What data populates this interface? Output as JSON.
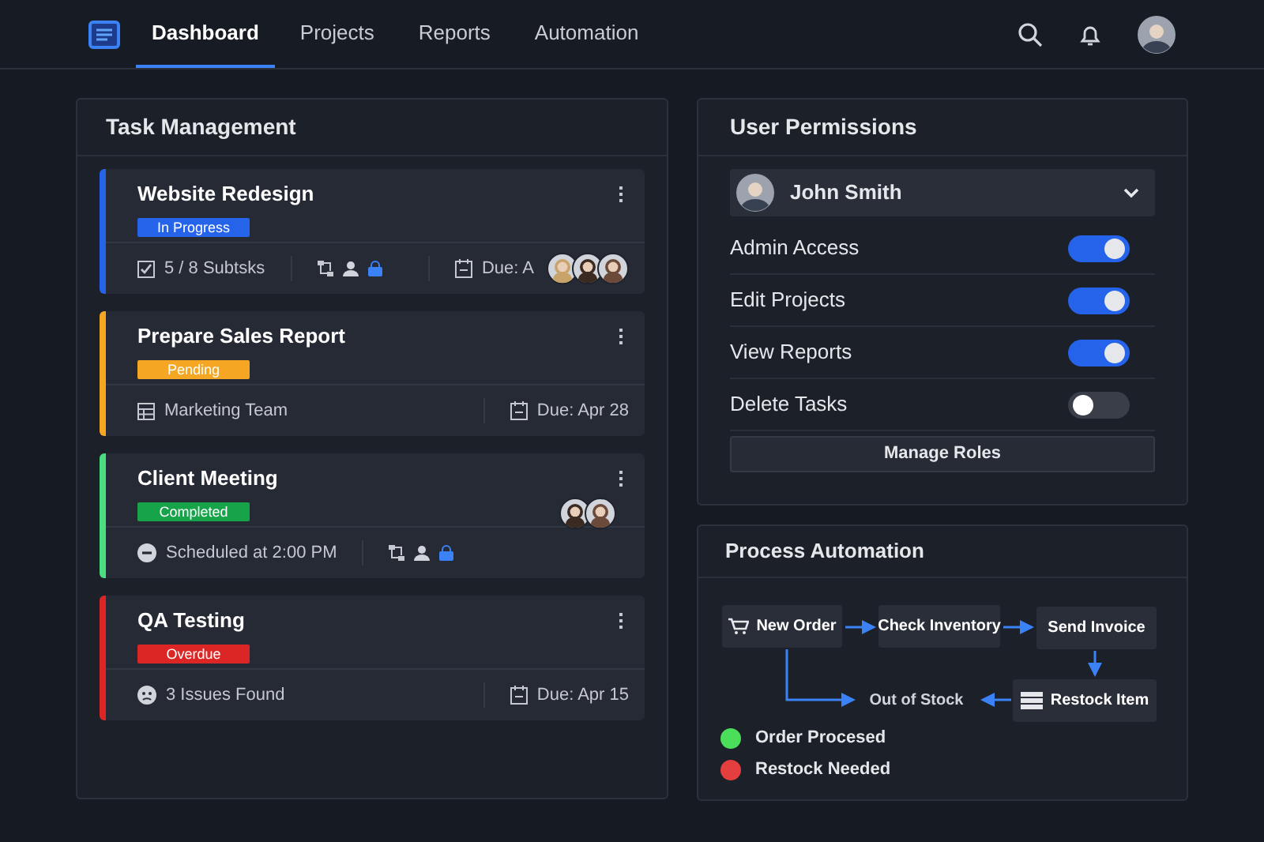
{
  "nav": {
    "items": [
      {
        "label": "Dashboard",
        "selected": true
      },
      {
        "label": "Projects",
        "selected": false
      },
      {
        "label": "Reports",
        "selected": false
      },
      {
        "label": "Automation",
        "selected": false
      }
    ]
  },
  "task_management": {
    "title": "Task Management",
    "tasks": [
      {
        "title": "Website Redesign",
        "status": {
          "kind": "in_progress",
          "label": "In Progress"
        },
        "footer": [
          {
            "kind": "check",
            "text": "5 / 8 Subtsks"
          },
          {
            "kind": "icons"
          },
          {
            "kind": "due",
            "text": "Due: A",
            "avatars": [
              {
                "kind": "picture"
              },
              {
                "kind": "picture"
              },
              {
                "kind": "picture"
              }
            ]
          }
        ]
      },
      {
        "title": "Prepare Sales Report",
        "status": {
          "kind": "pending",
          "label": "Pending"
        },
        "footer": [
          {
            "kind": "team",
            "text": "Marketing Team"
          },
          {
            "kind": "due",
            "text": "Due: Apr 28"
          }
        ]
      },
      {
        "title": "Client Meeting",
        "status": {
          "kind": "completed",
          "label": "Completed"
        },
        "top_avatars": [
          {
            "kind": "picture"
          },
          {
            "kind": "picture"
          }
        ],
        "footer": [
          {
            "kind": "clock",
            "text": "Scheduled at 2:00 PM"
          },
          {
            "kind": "icons"
          }
        ]
      },
      {
        "title": "QA Testing",
        "status": {
          "kind": "overdue",
          "label": "Overdue"
        },
        "footer": [
          {
            "kind": "bug",
            "text": "3 Issues Found"
          },
          {
            "kind": "due",
            "text": "Due: Apr 15"
          }
        ]
      }
    ]
  },
  "user_permissions": {
    "title": "User Permissions",
    "user": "John Smith",
    "permissions": [
      {
        "label": "Admin Access",
        "on": true
      },
      {
        "label": "Edit Projects",
        "on": true
      },
      {
        "label": "View Reports",
        "on": true
      },
      {
        "label": "Delete Tasks",
        "on": false
      }
    ],
    "button": "Manage Roles"
  },
  "process_automation": {
    "title": "Process Automation",
    "nodes": [
      {
        "label": "New Order",
        "kind": "cart"
      },
      {
        "label": "Check Inventory",
        "kind": "plain"
      },
      {
        "label": "Send Invoice",
        "kind": "plain"
      },
      {
        "label": "Out of Stock",
        "kind": "text"
      },
      {
        "label": "Restock Item",
        "kind": "stack"
      }
    ],
    "legend": [
      {
        "label": "Order Procesed",
        "color": "#4ade5a"
      },
      {
        "label": "Restock Needed",
        "color": "#e53e3e"
      }
    ]
  }
}
